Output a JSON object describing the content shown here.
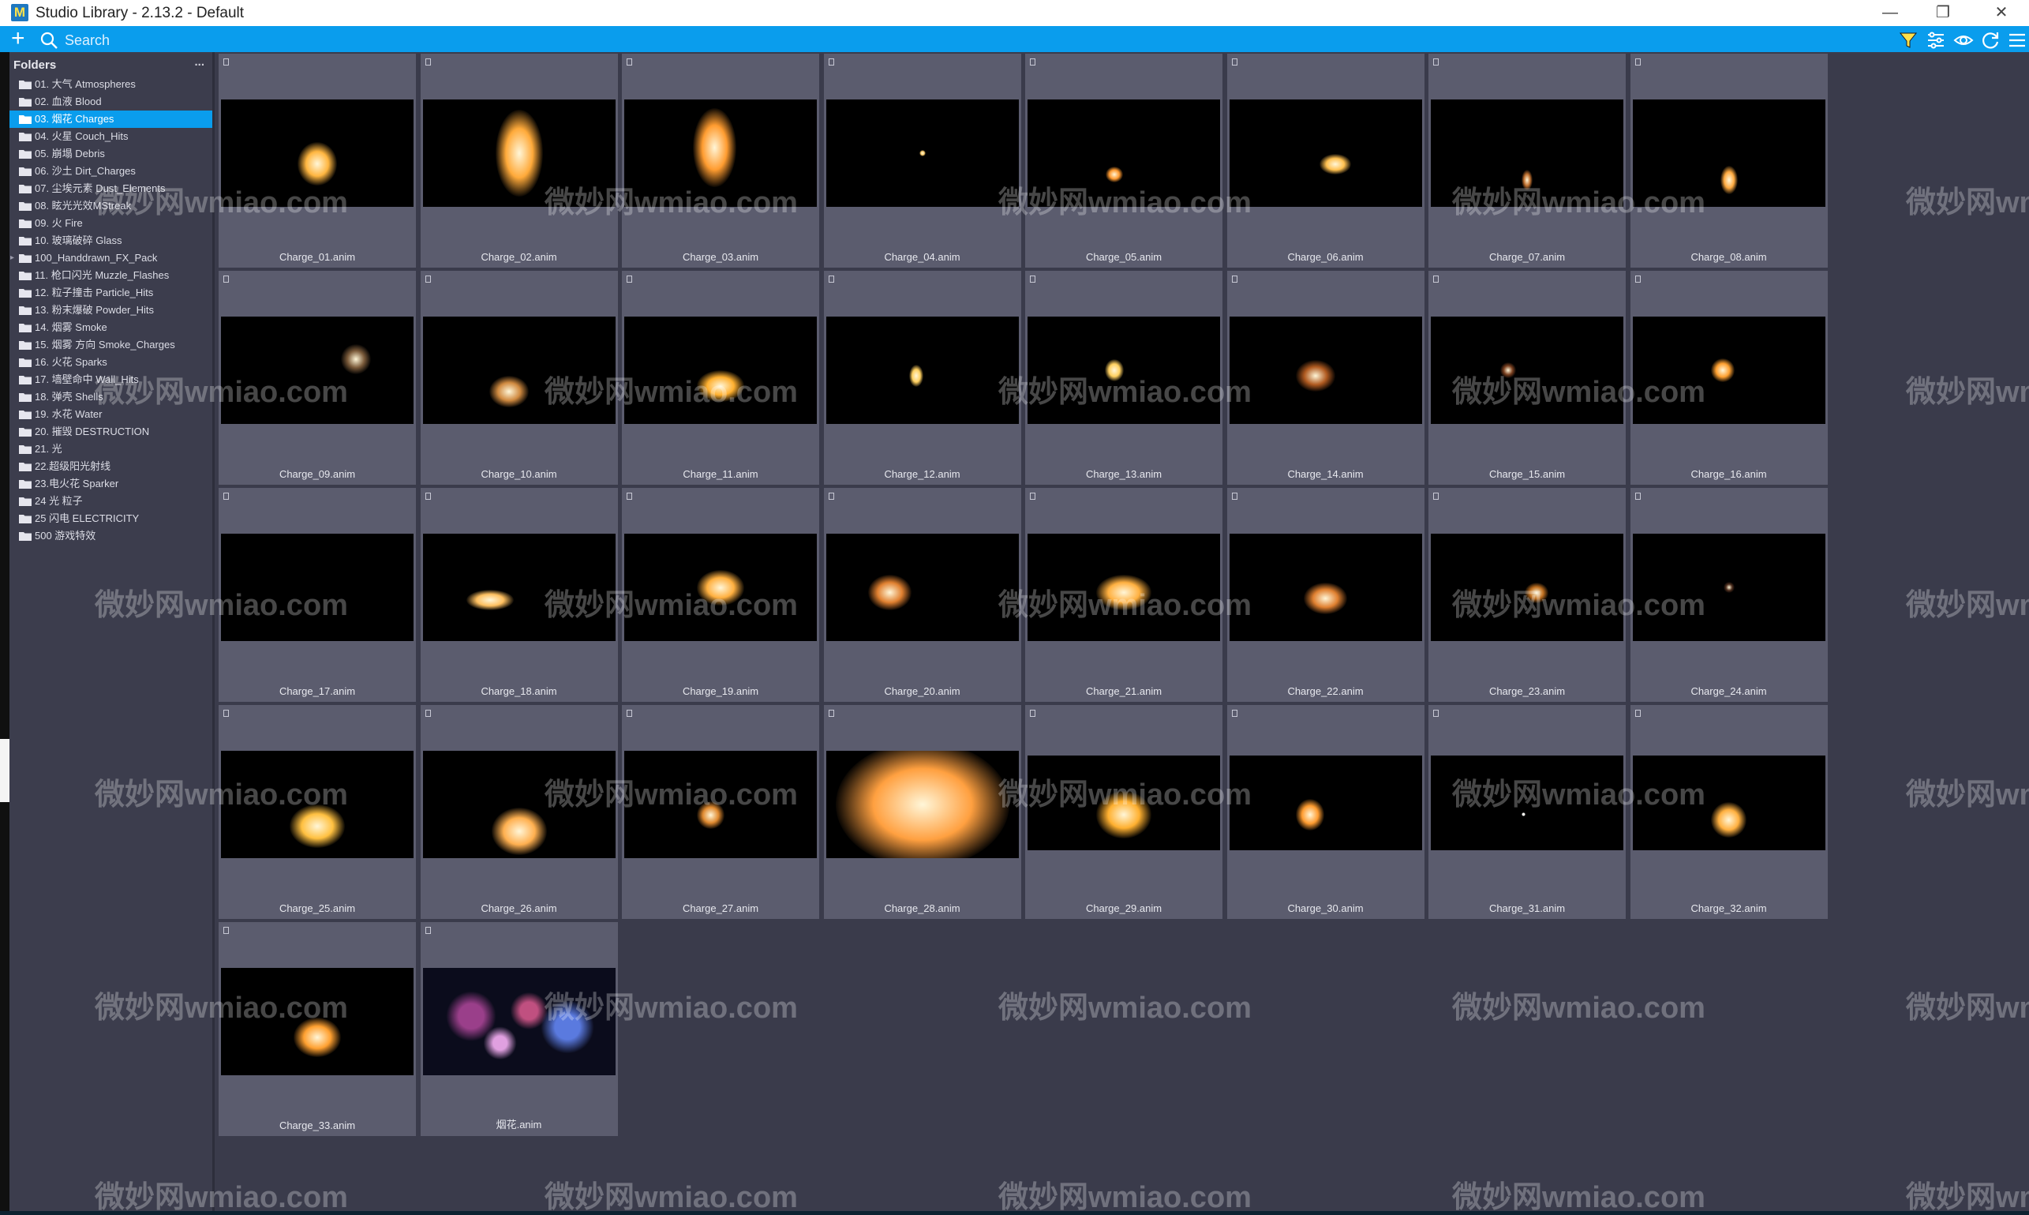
{
  "window": {
    "title": "Studio Library - 2.13.2 - Default",
    "minimize": "—",
    "maximize": "❐",
    "close": "✕"
  },
  "toolbar": {
    "add_label": "+",
    "search_placeholder": "Search",
    "icons": [
      "filter-icon",
      "sliders-icon",
      "eye-icon",
      "refresh-icon",
      "menu-icon"
    ]
  },
  "sidebar": {
    "header": "Folders",
    "more": "...",
    "items": [
      {
        "label": "01. 大气 Atmospheres",
        "selected": false
      },
      {
        "label": "02. 血液 Blood",
        "selected": false
      },
      {
        "label": "03. 烟花 Charges",
        "selected": true
      },
      {
        "label": "04. 火星 Couch_Hits",
        "selected": false
      },
      {
        "label": "05. 崩塌 Debris",
        "selected": false
      },
      {
        "label": "06. 沙土 Dirt_Charges",
        "selected": false
      },
      {
        "label": "07. 尘埃元素 Dust_Elements",
        "selected": false
      },
      {
        "label": "08. 眩光光效MStreak",
        "selected": false
      },
      {
        "label": "09. 火 Fire",
        "selected": false
      },
      {
        "label": "10. 玻璃破碎 Glass",
        "selected": false
      },
      {
        "label": "100_Handdrawn_FX_Pack",
        "selected": false,
        "expandable": true
      },
      {
        "label": "11. 枪口闪光 Muzzle_Flashes",
        "selected": false
      },
      {
        "label": "12. 粒子撞击 Particle_Hits",
        "selected": false
      },
      {
        "label": "13. 粉末爆破 Powder_Hits",
        "selected": false
      },
      {
        "label": "14. 烟雾 Smoke",
        "selected": false
      },
      {
        "label": "15. 烟雾 方向 Smoke_Charges",
        "selected": false
      },
      {
        "label": "16. 火花 Sparks",
        "selected": false
      },
      {
        "label": "17. 墙壁命中 Wall_Hits",
        "selected": false
      },
      {
        "label": "18. 弹壳 Shells",
        "selected": false
      },
      {
        "label": "19. 水花 Water",
        "selected": false
      },
      {
        "label": "20. 摧毁 DESTRUCTION",
        "selected": false
      },
      {
        "label": "21. 光",
        "selected": false
      },
      {
        "label": "22.超级阳光射线",
        "selected": false
      },
      {
        "label": "23.电火花 Sparker",
        "selected": false
      },
      {
        "label": "24 光 粒子",
        "selected": false
      },
      {
        "label": "25 闪电 ELECTRICITY",
        "selected": false
      },
      {
        "label": "500 游戏特效",
        "selected": false
      }
    ]
  },
  "items": [
    "Charge_01.anim",
    "Charge_02.anim",
    "Charge_03.anim",
    "Charge_04.anim",
    "Charge_05.anim",
    "Charge_06.anim",
    "Charge_07.anim",
    "Charge_08.anim",
    "Charge_09.anim",
    "Charge_10.anim",
    "Charge_11.anim",
    "Charge_12.anim",
    "Charge_13.anim",
    "Charge_14.anim",
    "Charge_15.anim",
    "Charge_16.anim",
    "Charge_17.anim",
    "Charge_18.anim",
    "Charge_19.anim",
    "Charge_20.anim",
    "Charge_21.anim",
    "Charge_22.anim",
    "Charge_23.anim",
    "Charge_24.anim",
    "Charge_25.anim",
    "Charge_26.anim",
    "Charge_27.anim",
    "Charge_28.anim",
    "Charge_29.anim",
    "Charge_30.anim",
    "Charge_31.anim",
    "Charge_32.anim",
    "Charge_33.anim",
    "烟花.anim"
  ],
  "watermark": "微妙网wmiao.com",
  "colors": {
    "accent": "#0a9ded",
    "panel": "#3c3d4d",
    "tile": "#5b5c6e",
    "background": "#3a3b4b"
  }
}
